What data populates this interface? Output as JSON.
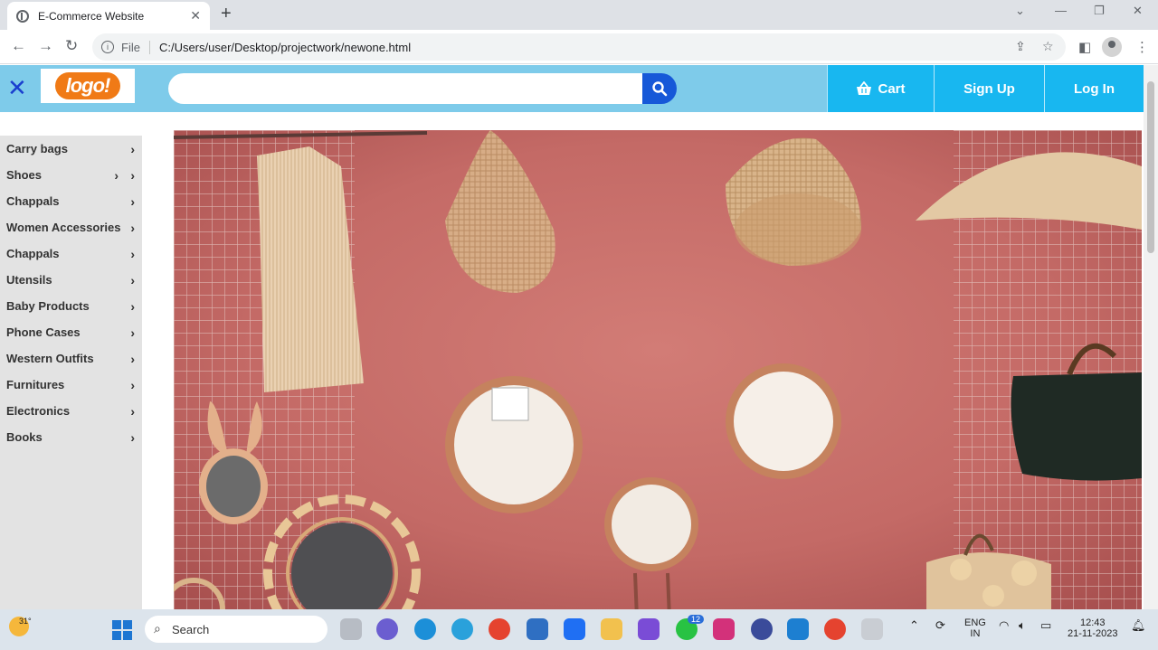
{
  "browser": {
    "tab_title": "E-Commerce Website",
    "url_scheme": "File",
    "url": "C:/Users/user/Desktop/projectwork/newone.html"
  },
  "header": {
    "logo_text": "logo!",
    "search_placeholder": "",
    "cart_label": "Cart",
    "signup_label": "Sign Up",
    "login_label": "Log In",
    "header_color": "#7ecbea",
    "button_color": "#18b7f0",
    "search_button_color": "#1658d8",
    "logo_color": "#f07a16"
  },
  "sidebar": {
    "items": [
      {
        "label": "Carry bags"
      },
      {
        "label": "Shoes"
      },
      {
        "label": "Chappals"
      },
      {
        "label": "Women Accessories"
      },
      {
        "label": "Chappals"
      },
      {
        "label": "Utensils"
      },
      {
        "label": "Baby Products"
      },
      {
        "label": "Phone Cases"
      },
      {
        "label": "Western Outfits"
      },
      {
        "label": "Furnitures"
      },
      {
        "label": "Electronics"
      },
      {
        "label": "Books"
      }
    ]
  },
  "taskbar": {
    "weather": "31°",
    "search_label": "Search",
    "badge_count": "12",
    "lang_line1": "ENG",
    "lang_line2": "IN",
    "time": "12:43",
    "date": "21-11-2023"
  }
}
